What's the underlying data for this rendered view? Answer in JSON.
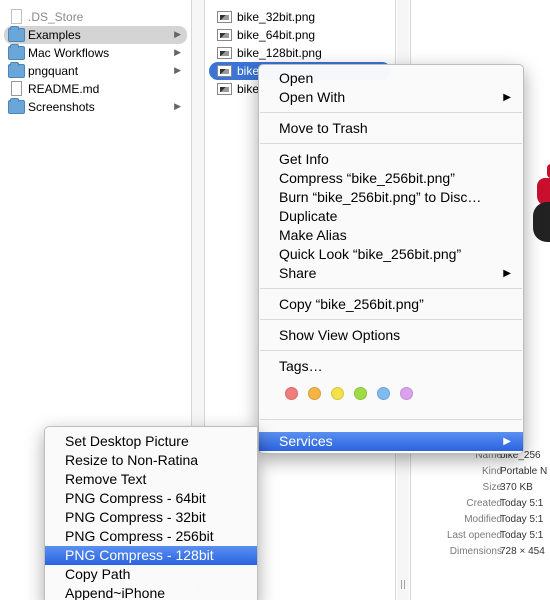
{
  "column1": {
    "items": [
      {
        "label": ".DS_Store",
        "icon": "document-icon",
        "dim": true
      },
      {
        "label": "Examples",
        "icon": "folder-icon",
        "selected": true,
        "arrow": true
      },
      {
        "label": "Mac Workflows",
        "icon": "folder-icon",
        "arrow": true
      },
      {
        "label": "pngquant",
        "icon": "folder-icon",
        "arrow": true
      },
      {
        "label": "README.md",
        "icon": "document-icon"
      },
      {
        "label": "Screenshots",
        "icon": "folder-icon",
        "arrow": true
      }
    ]
  },
  "column2": {
    "items": [
      {
        "label": "bike_32bit.png"
      },
      {
        "label": "bike_64bit.png"
      },
      {
        "label": "bike_128bit.png"
      },
      {
        "label": "bike",
        "selected": true
      },
      {
        "label": "bike"
      }
    ]
  },
  "preview_info": {
    "rows": [
      {
        "key": "Name",
        "value": "bike_256"
      },
      {
        "key": "Kind",
        "value": "Portable N"
      },
      {
        "key": "Size",
        "value": "370 KB"
      },
      {
        "key": "Created",
        "value": "Today 5:1"
      },
      {
        "key": "Modified",
        "value": "Today 5:1"
      },
      {
        "key": "Last opened",
        "value": "Today 5:1"
      },
      {
        "key": "Dimensions",
        "value": "728 × 454"
      }
    ]
  },
  "context_menu": {
    "items": {
      "open": "Open",
      "open_with": "Open With",
      "move_to_trash": "Move to Trash",
      "get_info": "Get Info",
      "compress": "Compress “bike_256bit.png”",
      "burn": "Burn “bike_256bit.png” to Disc…",
      "duplicate": "Duplicate",
      "make_alias": "Make Alias",
      "quick_look": "Quick Look “bike_256bit.png”",
      "share": "Share",
      "copy": "Copy “bike_256bit.png”",
      "show_view_options": "Show View Options",
      "tags": "Tags…",
      "services": "Services"
    },
    "tag_colors": [
      "#f07c7c",
      "#f6b445",
      "#f2e14a",
      "#9fdc43",
      "#7fbaf2",
      "#dba1ef"
    ]
  },
  "services_menu": {
    "items": [
      {
        "label": "Set Desktop Picture"
      },
      {
        "label": "Resize to Non-Ratina"
      },
      {
        "label": "Remove Text"
      },
      {
        "label": "PNG Compress - 64bit"
      },
      {
        "label": "PNG Compress - 32bit"
      },
      {
        "label": "PNG Compress - 256bit"
      },
      {
        "label": "PNG Compress - 128bit",
        "highlighted": true
      },
      {
        "label": "Copy Path"
      },
      {
        "label": "Append~iPhone"
      }
    ]
  },
  "colors": {
    "selection_blue": "#3b74d6",
    "menu_highlight": "#2b63e0"
  }
}
